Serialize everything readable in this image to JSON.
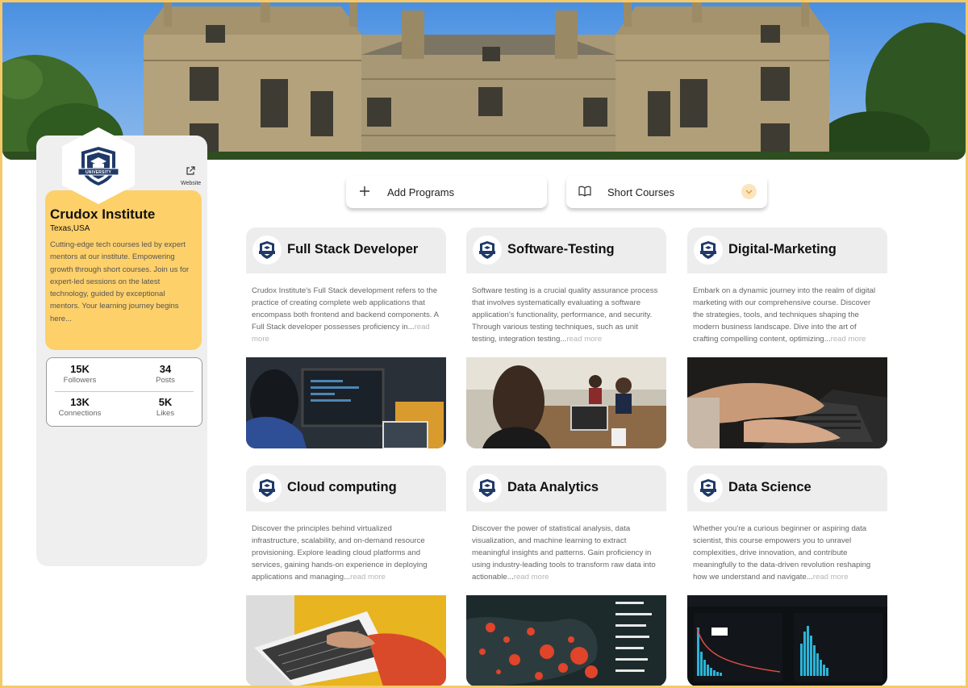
{
  "profile": {
    "name": "Crudox Institute",
    "location": "Texas,USA",
    "description": "Cutting-edge tech courses led by expert mentors at our institute. Empowering growth through short courses. Join us for expert-led sessions on the latest technology, guided by exceptional mentors. Your learning journey begins here...",
    "website_label": "Website",
    "logo_text": "UNIVERSITY",
    "stats": [
      {
        "value": "15K",
        "label": "Followers"
      },
      {
        "value": "34",
        "label": "Posts"
      },
      {
        "value": "13K",
        "label": "Connections"
      },
      {
        "value": "5K",
        "label": "Likes"
      }
    ]
  },
  "actions": {
    "add_programs": "Add Programs",
    "short_courses": "Short Courses"
  },
  "read_more": "read more",
  "courses": [
    {
      "title": "Full Stack Developer",
      "description": "Crudox Institute's  Full Stack development refers to the practice of creating complete web applications that encompass both frontend and backend components. A Full Stack developer possesses proficiency in..."
    },
    {
      "title": "Software-Testing",
      "description": "Software testing is a crucial quality assurance process that involves systematically evaluating a software application's functionality, performance, and security. Through various testing techniques, such as unit testing, integration testing..."
    },
    {
      "title": "Digital-Marketing",
      "description": "Embark on a dynamic journey into the realm of digital marketing with our comprehensive course. Discover the strategies, tools, and techniques shaping the modern business landscape. Dive into the art of crafting compelling content, optimizing..."
    },
    {
      "title": "Cloud computing",
      "description": "Discover the principles behind virtualized infrastructure, scalability, and on-demand resource provisioning. Explore leading cloud platforms and services, gaining hands-on experience in deploying applications and managing..."
    },
    {
      "title": "Data Analytics",
      "description": "Discover the power of statistical analysis, data visualization, and machine learning to extract meaningful insights and patterns. Gain proficiency in using industry-leading tools to transform raw data into actionable..."
    },
    {
      "title": "Data Science",
      "description": "Whether you're a curious beginner or aspiring data scientist, this course empowers you to unravel complexities, drive innovation, and contribute meaningfully to the data-driven revolution reshaping how we understand and navigate..."
    }
  ],
  "colors": {
    "accent": "#fdd06a",
    "frame": "#f5c96a",
    "logo_navy": "#1f3a68"
  }
}
